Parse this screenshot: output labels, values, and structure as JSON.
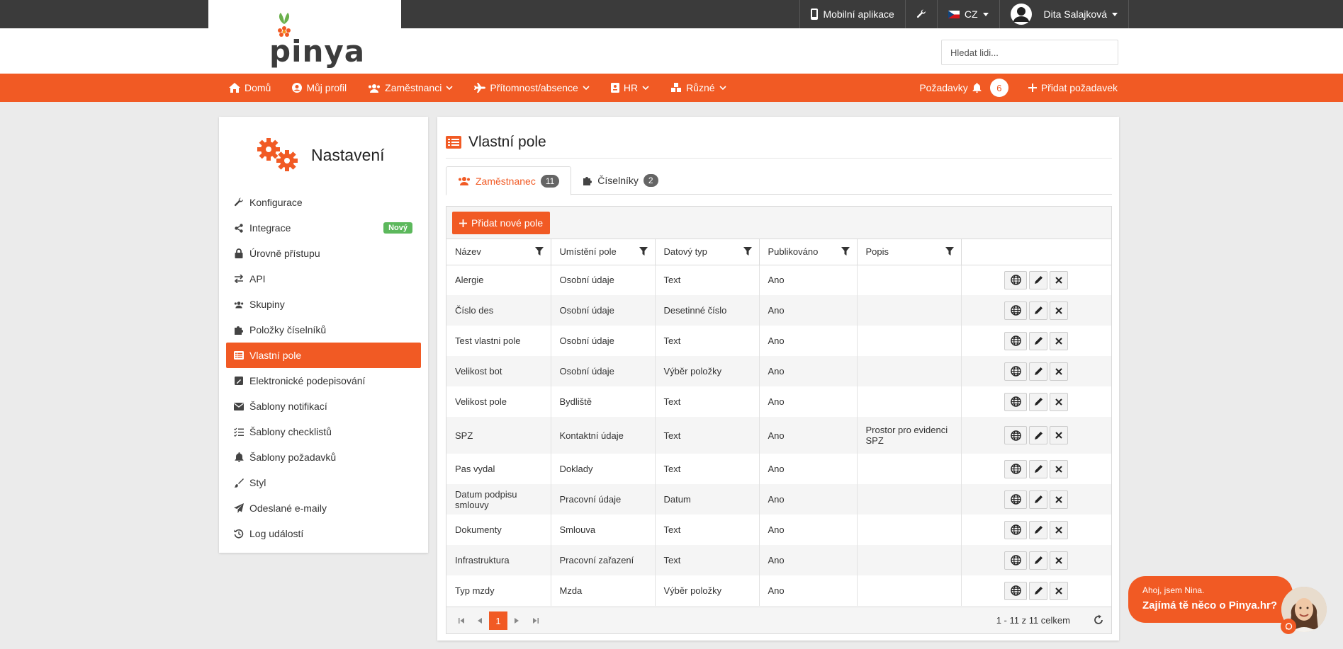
{
  "topbar": {
    "mobile_app": "Mobilní aplikace",
    "language": "CZ",
    "user_name": "Dita Salajková"
  },
  "logo": {
    "text": "pinya"
  },
  "search": {
    "placeholder": "Hledat lidi..."
  },
  "nav": {
    "items": [
      "Domů",
      "Můj profil",
      "Zaměstnanci",
      "Přítomnost/absence",
      "HR",
      "Různé"
    ],
    "requests_label": "Požadavky",
    "requests_count": "6",
    "add_request_label": "Přidat požadavek"
  },
  "sidebar": {
    "title": "Nastavení",
    "new_badge": "Nový",
    "items": [
      {
        "label": "Konfigurace",
        "icon": "wrench-icon"
      },
      {
        "label": "Integrace",
        "icon": "share-icon"
      },
      {
        "label": "Úrovně přístupu",
        "icon": "lock-icon"
      },
      {
        "label": "API",
        "icon": "exchange-icon"
      },
      {
        "label": "Skupiny",
        "icon": "users-icon"
      },
      {
        "label": "Položky číselníků",
        "icon": "puzzle-icon"
      },
      {
        "label": "Vlastní pole",
        "icon": "list-icon"
      },
      {
        "label": "Elektronické podepisování",
        "icon": "signature-icon"
      },
      {
        "label": "Šablony notifikací",
        "icon": "envelope-icon"
      },
      {
        "label": "Šablony checklistů",
        "icon": "checklist-icon"
      },
      {
        "label": "Šablony požadavků",
        "icon": "bell-icon"
      },
      {
        "label": "Styl",
        "icon": "brush-icon"
      },
      {
        "label": "Odeslané e-maily",
        "icon": "paper-plane-icon"
      },
      {
        "label": "Log událostí",
        "icon": "history-icon"
      }
    ]
  },
  "main": {
    "title": "Vlastní pole",
    "tabs": [
      {
        "label": "Zaměstnanec",
        "count": "11"
      },
      {
        "label": "Číselníky",
        "count": "2"
      }
    ],
    "add_button": "Přidat nové pole",
    "columns": [
      "Název",
      "Umístění pole",
      "Datový typ",
      "Publikováno",
      "Popis"
    ],
    "rows": [
      {
        "name": "Alergie",
        "location": "Osobní údaje",
        "type": "Text",
        "published": "Ano",
        "desc": ""
      },
      {
        "name": "Číslo des",
        "location": "Osobní údaje",
        "type": "Desetinné číslo",
        "published": "Ano",
        "desc": ""
      },
      {
        "name": "Test vlastni pole",
        "location": "Osobní údaje",
        "type": "Text",
        "published": "Ano",
        "desc": ""
      },
      {
        "name": "Velikost bot",
        "location": "Osobní údaje",
        "type": "Výběr položky",
        "published": "Ano",
        "desc": ""
      },
      {
        "name": "Velikost pole",
        "location": "Bydliště",
        "type": "Text",
        "published": "Ano",
        "desc": ""
      },
      {
        "name": "SPZ",
        "location": "Kontaktní údaje",
        "type": "Text",
        "published": "Ano",
        "desc": "Prostor pro evidenci SPZ"
      },
      {
        "name": "Pas vydal",
        "location": "Doklady",
        "type": "Text",
        "published": "Ano",
        "desc": ""
      },
      {
        "name": "Datum podpisu smlouvy",
        "location": "Pracovní údaje",
        "type": "Datum",
        "published": "Ano",
        "desc": ""
      },
      {
        "name": "Dokumenty",
        "location": "Smlouva",
        "type": "Text",
        "published": "Ano",
        "desc": ""
      },
      {
        "name": "Infrastruktura",
        "location": "Pracovní zařazení",
        "type": "Text",
        "published": "Ano",
        "desc": ""
      },
      {
        "name": "Typ mzdy",
        "location": "Mzda",
        "type": "Výběr položky",
        "published": "Ano",
        "desc": ""
      }
    ],
    "pager": {
      "current": "1",
      "info": "1 - 11 z 11 celkem"
    }
  },
  "chat": {
    "greeting": "Ahoj, jsem Nina.",
    "question": "Zajímá tě něco o Pinya.hr?"
  },
  "colors": {
    "accent": "#f15a24",
    "topbar": "#3b3b3b",
    "badge_green": "#5cb85c"
  }
}
